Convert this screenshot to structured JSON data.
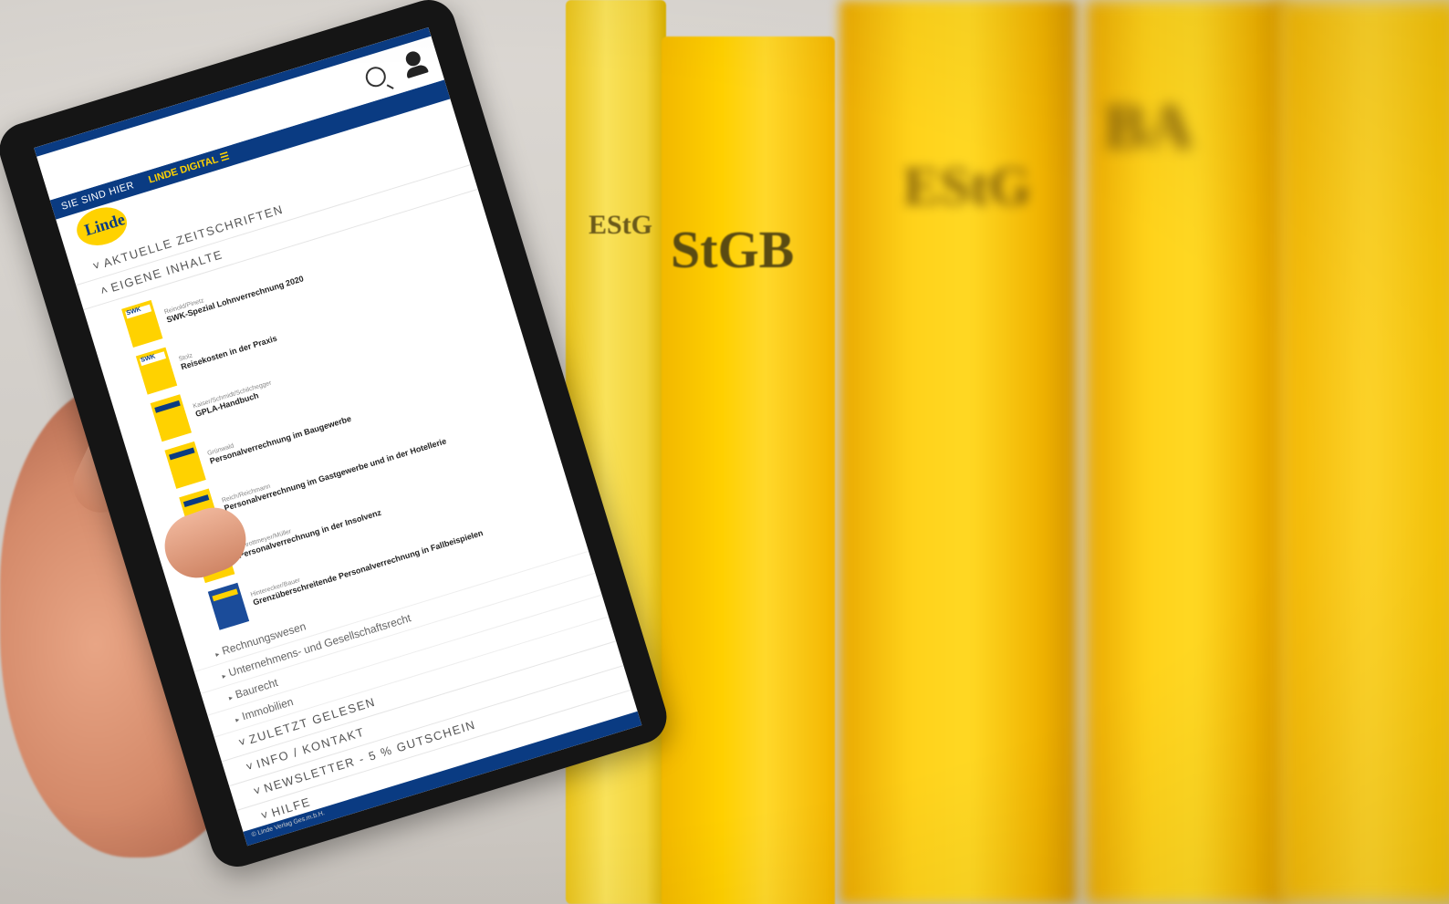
{
  "topbar": {
    "breadcrumb_label": "SIE SIND HIER",
    "breadcrumb_current": "LINDE DIGITAL ☰"
  },
  "logo_text": "Linde",
  "sections": {
    "current_journals": "AKTUELLE ZEITSCHRIFTEN",
    "own_content": "EIGENE INHALTE",
    "recently_read": "ZULETZT GELESEN",
    "info_contact": "INFO / KONTAKT",
    "newsletter": "NEWSLETTER - 5 % GUTSCHEIN",
    "help": "HILFE"
  },
  "items": [
    {
      "author": "Reinold/Pinetz",
      "title": "SWK-Spezial Lohnverrechnung 2020"
    },
    {
      "author": "Stolz",
      "title": "Reisekosten in der Praxis"
    },
    {
      "author": "Kaiser/Schmidt/Schilchegger",
      "title": "GPLA-Handbuch"
    },
    {
      "author": "Grünwald",
      "title": "Personalverrechnung im Baugewerbe"
    },
    {
      "author": "Reich/Reichmann",
      "title": "Personalverrechnung im Gastgewerbe und in der Hotellerie"
    },
    {
      "author": "Schrottmeyer/Müller",
      "title": "Personalverrechnung in der Insolvenz"
    },
    {
      "author": "Hinterecker/Bauer",
      "title": "Grenzüberschreitende Personalverrechnung in Fallbeispielen"
    }
  ],
  "categories": [
    "Rechnungswesen",
    "Unternehmens- und Gesellschaftsrecht",
    "Baurecht",
    "Immobilien"
  ],
  "footer": "© Linde Verlag Ges.m.b.H.",
  "shelf": {
    "spine1": "EStG",
    "spine2": "StGB",
    "spine3": "EStG",
    "spine4": "BA"
  }
}
